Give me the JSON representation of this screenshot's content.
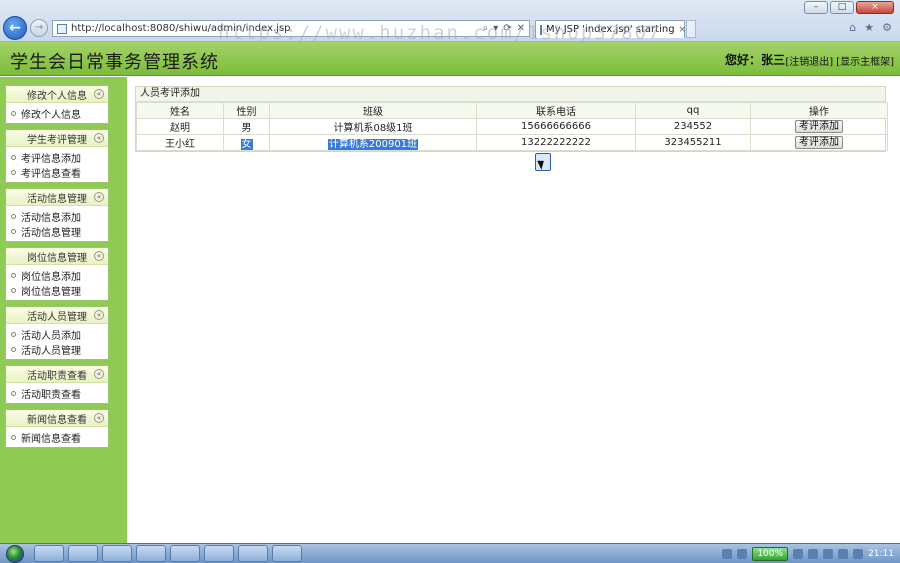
{
  "browser": {
    "back_icon": "arrow-left-icon",
    "url": "http://localhost:8080/shiwu/admin/index.jsp",
    "tab_title": "My JSP 'index.jsp' starting",
    "tab_close": "×",
    "win_min": "–",
    "win_max": "□",
    "win_close": "×",
    "addr_tools": [
      "⌕",
      "▾",
      "⟳",
      "✕"
    ],
    "chrome_icons": [
      "⌂",
      "★",
      "⚙"
    ]
  },
  "watermark": "https://www.huzhan.com/1shop37807",
  "app": {
    "title": "学生会日常事务管理系统",
    "greeting": "您好：张三",
    "logout_link": "[注销退出]",
    "home_link": "[显示主框架]"
  },
  "sidebar": {
    "menus": [
      {
        "title": "修改个人信息",
        "toggle": "«",
        "items": [
          "修改个人信息"
        ]
      },
      {
        "title": "学生考评管理",
        "toggle": "«",
        "items": [
          "考评信息添加",
          "考评信息查看"
        ]
      },
      {
        "title": "活动信息管理",
        "toggle": "«",
        "items": [
          "活动信息添加",
          "活动信息管理"
        ]
      },
      {
        "title": "岗位信息管理",
        "toggle": "«",
        "items": [
          "岗位信息添加",
          "岗位信息管理"
        ]
      },
      {
        "title": "活动人员管理",
        "toggle": "«",
        "items": [
          "活动人员添加",
          "活动人员管理"
        ]
      },
      {
        "title": "活动职责查看",
        "toggle": "«",
        "items": [
          "活动职责查看"
        ]
      },
      {
        "title": "新闻信息查看",
        "toggle": "«",
        "items": [
          "新闻信息查看"
        ]
      }
    ]
  },
  "panel": {
    "title": "人员考评添加",
    "columns": [
      "姓名",
      "性别",
      "班级",
      "联系电话",
      "qq",
      "操作"
    ],
    "rows": [
      {
        "name": "赵明",
        "gender": "男",
        "class": "计算机系08级1班",
        "phone": "15666666666",
        "qq": "234552",
        "action": "考评添加"
      },
      {
        "name": "王小红",
        "gender": "女",
        "class": "计算机系200901班",
        "phone": "13222222222",
        "qq": "323455211",
        "action": "考评添加"
      }
    ]
  },
  "taskbar": {
    "battery": "100%",
    "clock": "21:11"
  }
}
